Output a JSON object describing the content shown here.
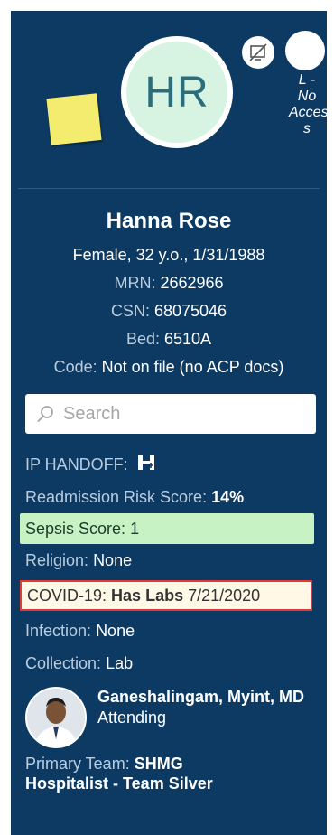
{
  "header": {
    "initials": "HR",
    "acp_note": "L - No Acces s"
  },
  "patient": {
    "name": "Hanna Rose",
    "demographics": "Female, 32 y.o., 1/31/1988",
    "mrn_label": "MRN:",
    "mrn": "2662966",
    "csn_label": "CSN:",
    "csn": "68075046",
    "bed_label": "Bed:",
    "bed": "6510A",
    "code_label": "Code:",
    "code": "Not on file (no ACP docs)"
  },
  "search": {
    "placeholder": "Search"
  },
  "rows": {
    "ip_handoff_label": "IP HANDOFF:",
    "readmission_label": "Readmission Risk Score:",
    "readmission_value": "14%",
    "sepsis_label": "Sepsis Score:",
    "sepsis_value": "1",
    "religion_label": "Religion:",
    "religion_value": "None",
    "covid_label": "COVID-19:",
    "covid_value": "Has Labs",
    "covid_date": "7/21/2020",
    "infection_label": "Infection:",
    "infection_value": "None",
    "collection_label": "Collection:",
    "collection_value": "Lab"
  },
  "attending": {
    "name": "Ganeshalingam, Myint, MD",
    "role": "Attending"
  },
  "team": {
    "label": "Primary Team:",
    "value_line1": "SHMG",
    "value_line2": "Hospitalist - Team Silver"
  },
  "colors": {
    "panel_bg": "#0d3a63",
    "sepsis_bg": "#c7f2c4",
    "covid_border": "#e03a3a",
    "sticky_note": "#f3ec6f"
  },
  "icons": [
    "media-disabled-icon",
    "search-icon",
    "handoff-icon",
    "sticky-note-icon"
  ]
}
